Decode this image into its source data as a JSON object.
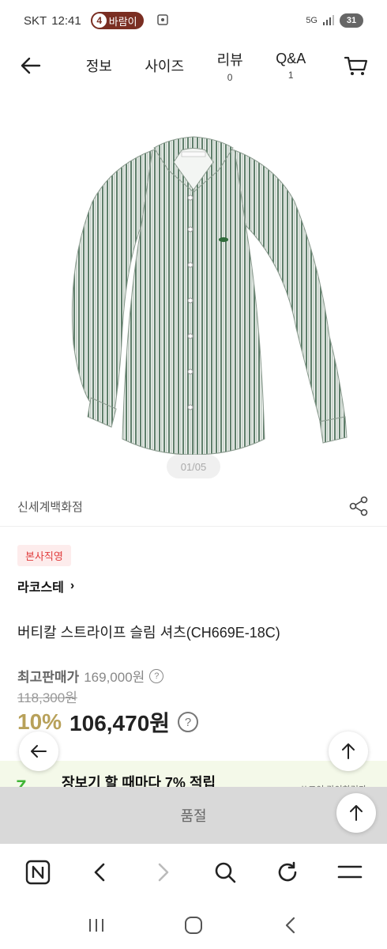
{
  "status_bar": {
    "carrier": "SKT",
    "time": "12:41",
    "notification_count": "4",
    "notification_label": "바람이",
    "network": "5G",
    "battery": "31"
  },
  "nav": {
    "tabs": [
      {
        "label": "정보",
        "count": ""
      },
      {
        "label": "사이즈",
        "count": ""
      },
      {
        "label": "리뷰",
        "count": "0"
      },
      {
        "label": "Q&A",
        "count": "1"
      }
    ]
  },
  "gallery": {
    "page_indicator": "01/05"
  },
  "store": {
    "name": "신세계백화점"
  },
  "product": {
    "badge": "본사직영",
    "brand": "라코스테",
    "brand_chevron": "›",
    "title": "버티칼 스트라이프 슬림 셔츠(CH669E-18C)",
    "max_price_label": "최고판매가",
    "max_price": "169,000원",
    "original_price": "118,300원",
    "discount": "10%",
    "sale_price": "106,470원",
    "help": "?"
  },
  "reward": {
    "icon_letter": "Z",
    "text": "장보기 할 때마다 7% 적립",
    "link": "쓰코이 라이하러가"
  },
  "soldout": {
    "label": "품절"
  },
  "colors": {
    "discount": "#b8a15a",
    "badge_text": "#e03c3c",
    "badge_bg": "#fdecec",
    "reward_bg": "#f4f9e9",
    "soldout_bg": "#d9d9d9",
    "shirt_green": "#5e7e6a"
  }
}
